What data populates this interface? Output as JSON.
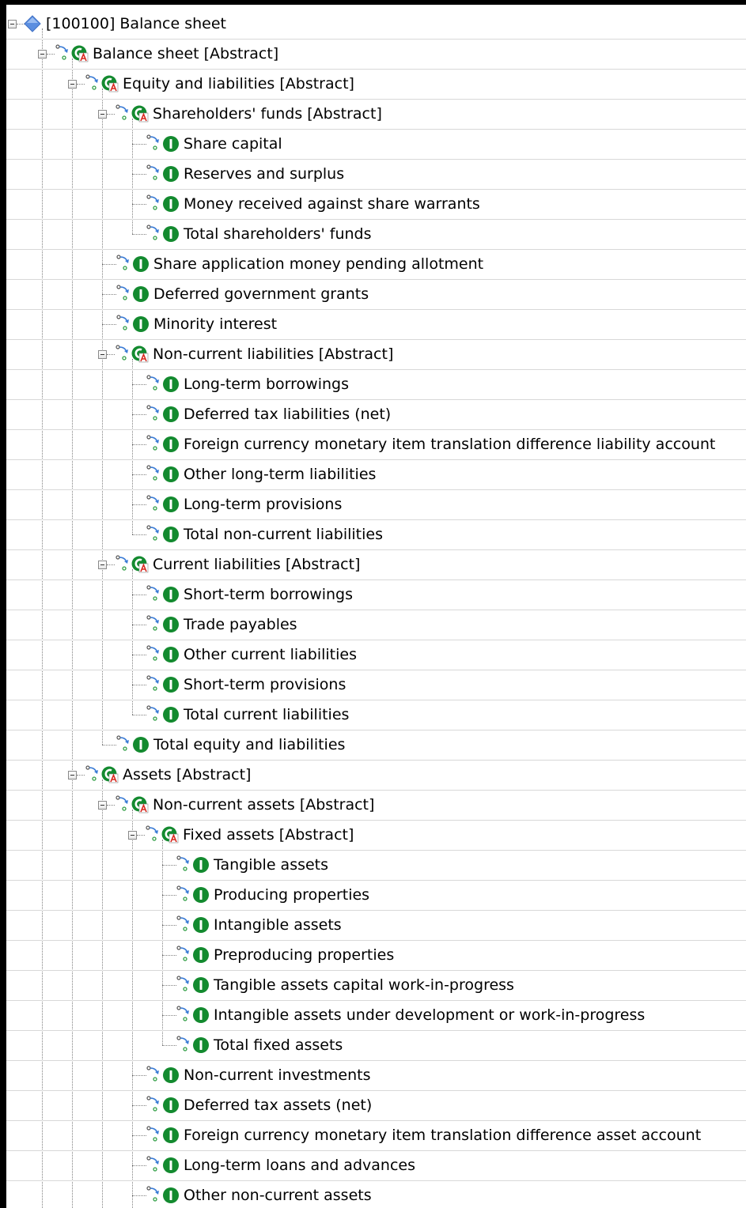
{
  "tree": {
    "nodes": [
      {
        "depth": 0,
        "kind": "root",
        "expanded": true,
        "label": "[100100] Balance sheet",
        "icon": "diamond-icon"
      },
      {
        "depth": 1,
        "kind": "abstract",
        "expanded": true,
        "label": "Balance sheet [Abstract]"
      },
      {
        "depth": 2,
        "kind": "abstract",
        "expanded": true,
        "label": "Equity and liabilities [Abstract]"
      },
      {
        "depth": 3,
        "kind": "abstract",
        "expanded": true,
        "label": "Shareholders' funds [Abstract]"
      },
      {
        "depth": 4,
        "kind": "item",
        "label": "Share capital"
      },
      {
        "depth": 4,
        "kind": "item",
        "label": "Reserves and surplus"
      },
      {
        "depth": 4,
        "kind": "item",
        "label": "Money received against share warrants"
      },
      {
        "depth": 4,
        "kind": "item",
        "label": "Total shareholders' funds"
      },
      {
        "depth": 3,
        "kind": "item",
        "label": "Share application money pending allotment"
      },
      {
        "depth": 3,
        "kind": "item",
        "label": "Deferred government grants"
      },
      {
        "depth": 3,
        "kind": "item",
        "label": "Minority interest"
      },
      {
        "depth": 3,
        "kind": "abstract",
        "expanded": true,
        "label": "Non-current liabilities [Abstract]"
      },
      {
        "depth": 4,
        "kind": "item",
        "label": "Long-term borrowings"
      },
      {
        "depth": 4,
        "kind": "item",
        "label": "Deferred tax liabilities (net)"
      },
      {
        "depth": 4,
        "kind": "item",
        "label": "Foreign currency monetary item translation difference liability account"
      },
      {
        "depth": 4,
        "kind": "item",
        "label": "Other long-term liabilities"
      },
      {
        "depth": 4,
        "kind": "item",
        "label": "Long-term provisions"
      },
      {
        "depth": 4,
        "kind": "item",
        "label": "Total non-current liabilities"
      },
      {
        "depth": 3,
        "kind": "abstract",
        "expanded": true,
        "label": "Current liabilities [Abstract]"
      },
      {
        "depth": 4,
        "kind": "item",
        "label": "Short-term borrowings"
      },
      {
        "depth": 4,
        "kind": "item",
        "label": "Trade payables"
      },
      {
        "depth": 4,
        "kind": "item",
        "label": "Other current liabilities"
      },
      {
        "depth": 4,
        "kind": "item",
        "label": "Short-term provisions"
      },
      {
        "depth": 4,
        "kind": "item",
        "label": "Total current liabilities"
      },
      {
        "depth": 3,
        "kind": "item",
        "label": "Total equity and liabilities"
      },
      {
        "depth": 2,
        "kind": "abstract",
        "expanded": true,
        "label": "Assets [Abstract]"
      },
      {
        "depth": 3,
        "kind": "abstract",
        "expanded": true,
        "label": "Non-current assets [Abstract]"
      },
      {
        "depth": 4,
        "kind": "abstract",
        "expanded": true,
        "label": "Fixed assets [Abstract]"
      },
      {
        "depth": 5,
        "kind": "item",
        "label": "Tangible assets"
      },
      {
        "depth": 5,
        "kind": "item",
        "label": "Producing properties"
      },
      {
        "depth": 5,
        "kind": "item",
        "label": "Intangible assets"
      },
      {
        "depth": 5,
        "kind": "item",
        "label": "Preproducing properties"
      },
      {
        "depth": 5,
        "kind": "item",
        "label": "Tangible assets capital work-in-progress"
      },
      {
        "depth": 5,
        "kind": "item",
        "label": "Intangible assets under development or work-in-progress"
      },
      {
        "depth": 5,
        "kind": "item",
        "label": "Total fixed assets"
      },
      {
        "depth": 4,
        "kind": "item",
        "label": "Non-current investments"
      },
      {
        "depth": 4,
        "kind": "item",
        "label": "Deferred tax assets (net)"
      },
      {
        "depth": 4,
        "kind": "item",
        "label": "Foreign currency monetary item translation difference asset account"
      },
      {
        "depth": 4,
        "kind": "item",
        "label": "Long-term loans and advances"
      },
      {
        "depth": 4,
        "kind": "item",
        "label": "Other non-current assets"
      }
    ]
  },
  "icons": {
    "item": "item-concept-icon",
    "abstract": "abstract-concept-icon",
    "link": "arc-link-icon",
    "toggle": "collapse-toggle-icon"
  },
  "colors": {
    "concept_green": "#138a2f",
    "abstract_badge_red": "#d9261c",
    "root_diamond": "#5b8ee0",
    "guide_line": "#808080",
    "row_divider": "#d8d8d8",
    "frame": "#000000"
  }
}
